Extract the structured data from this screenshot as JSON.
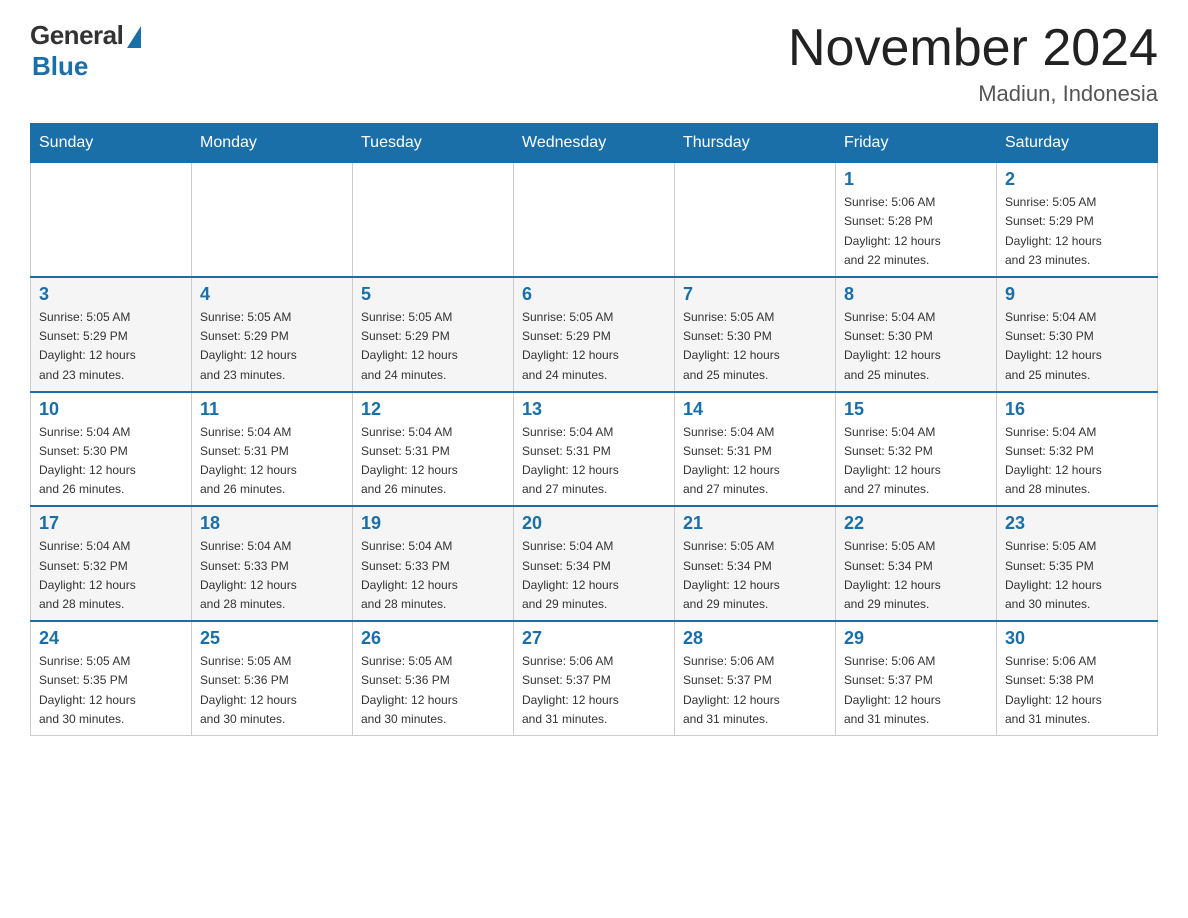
{
  "header": {
    "logo_general": "General",
    "logo_blue": "Blue",
    "month_title": "November 2024",
    "location": "Madiun, Indonesia"
  },
  "weekdays": [
    "Sunday",
    "Monday",
    "Tuesday",
    "Wednesday",
    "Thursday",
    "Friday",
    "Saturday"
  ],
  "weeks": [
    [
      {
        "day": "",
        "info": ""
      },
      {
        "day": "",
        "info": ""
      },
      {
        "day": "",
        "info": ""
      },
      {
        "day": "",
        "info": ""
      },
      {
        "day": "",
        "info": ""
      },
      {
        "day": "1",
        "info": "Sunrise: 5:06 AM\nSunset: 5:28 PM\nDaylight: 12 hours\nand 22 minutes."
      },
      {
        "day": "2",
        "info": "Sunrise: 5:05 AM\nSunset: 5:29 PM\nDaylight: 12 hours\nand 23 minutes."
      }
    ],
    [
      {
        "day": "3",
        "info": "Sunrise: 5:05 AM\nSunset: 5:29 PM\nDaylight: 12 hours\nand 23 minutes."
      },
      {
        "day": "4",
        "info": "Sunrise: 5:05 AM\nSunset: 5:29 PM\nDaylight: 12 hours\nand 23 minutes."
      },
      {
        "day": "5",
        "info": "Sunrise: 5:05 AM\nSunset: 5:29 PM\nDaylight: 12 hours\nand 24 minutes."
      },
      {
        "day": "6",
        "info": "Sunrise: 5:05 AM\nSunset: 5:29 PM\nDaylight: 12 hours\nand 24 minutes."
      },
      {
        "day": "7",
        "info": "Sunrise: 5:05 AM\nSunset: 5:30 PM\nDaylight: 12 hours\nand 25 minutes."
      },
      {
        "day": "8",
        "info": "Sunrise: 5:04 AM\nSunset: 5:30 PM\nDaylight: 12 hours\nand 25 minutes."
      },
      {
        "day": "9",
        "info": "Sunrise: 5:04 AM\nSunset: 5:30 PM\nDaylight: 12 hours\nand 25 minutes."
      }
    ],
    [
      {
        "day": "10",
        "info": "Sunrise: 5:04 AM\nSunset: 5:30 PM\nDaylight: 12 hours\nand 26 minutes."
      },
      {
        "day": "11",
        "info": "Sunrise: 5:04 AM\nSunset: 5:31 PM\nDaylight: 12 hours\nand 26 minutes."
      },
      {
        "day": "12",
        "info": "Sunrise: 5:04 AM\nSunset: 5:31 PM\nDaylight: 12 hours\nand 26 minutes."
      },
      {
        "day": "13",
        "info": "Sunrise: 5:04 AM\nSunset: 5:31 PM\nDaylight: 12 hours\nand 27 minutes."
      },
      {
        "day": "14",
        "info": "Sunrise: 5:04 AM\nSunset: 5:31 PM\nDaylight: 12 hours\nand 27 minutes."
      },
      {
        "day": "15",
        "info": "Sunrise: 5:04 AM\nSunset: 5:32 PM\nDaylight: 12 hours\nand 27 minutes."
      },
      {
        "day": "16",
        "info": "Sunrise: 5:04 AM\nSunset: 5:32 PM\nDaylight: 12 hours\nand 28 minutes."
      }
    ],
    [
      {
        "day": "17",
        "info": "Sunrise: 5:04 AM\nSunset: 5:32 PM\nDaylight: 12 hours\nand 28 minutes."
      },
      {
        "day": "18",
        "info": "Sunrise: 5:04 AM\nSunset: 5:33 PM\nDaylight: 12 hours\nand 28 minutes."
      },
      {
        "day": "19",
        "info": "Sunrise: 5:04 AM\nSunset: 5:33 PM\nDaylight: 12 hours\nand 28 minutes."
      },
      {
        "day": "20",
        "info": "Sunrise: 5:04 AM\nSunset: 5:34 PM\nDaylight: 12 hours\nand 29 minutes."
      },
      {
        "day": "21",
        "info": "Sunrise: 5:05 AM\nSunset: 5:34 PM\nDaylight: 12 hours\nand 29 minutes."
      },
      {
        "day": "22",
        "info": "Sunrise: 5:05 AM\nSunset: 5:34 PM\nDaylight: 12 hours\nand 29 minutes."
      },
      {
        "day": "23",
        "info": "Sunrise: 5:05 AM\nSunset: 5:35 PM\nDaylight: 12 hours\nand 30 minutes."
      }
    ],
    [
      {
        "day": "24",
        "info": "Sunrise: 5:05 AM\nSunset: 5:35 PM\nDaylight: 12 hours\nand 30 minutes."
      },
      {
        "day": "25",
        "info": "Sunrise: 5:05 AM\nSunset: 5:36 PM\nDaylight: 12 hours\nand 30 minutes."
      },
      {
        "day": "26",
        "info": "Sunrise: 5:05 AM\nSunset: 5:36 PM\nDaylight: 12 hours\nand 30 minutes."
      },
      {
        "day": "27",
        "info": "Sunrise: 5:06 AM\nSunset: 5:37 PM\nDaylight: 12 hours\nand 31 minutes."
      },
      {
        "day": "28",
        "info": "Sunrise: 5:06 AM\nSunset: 5:37 PM\nDaylight: 12 hours\nand 31 minutes."
      },
      {
        "day": "29",
        "info": "Sunrise: 5:06 AM\nSunset: 5:37 PM\nDaylight: 12 hours\nand 31 minutes."
      },
      {
        "day": "30",
        "info": "Sunrise: 5:06 AM\nSunset: 5:38 PM\nDaylight: 12 hours\nand 31 minutes."
      }
    ]
  ]
}
